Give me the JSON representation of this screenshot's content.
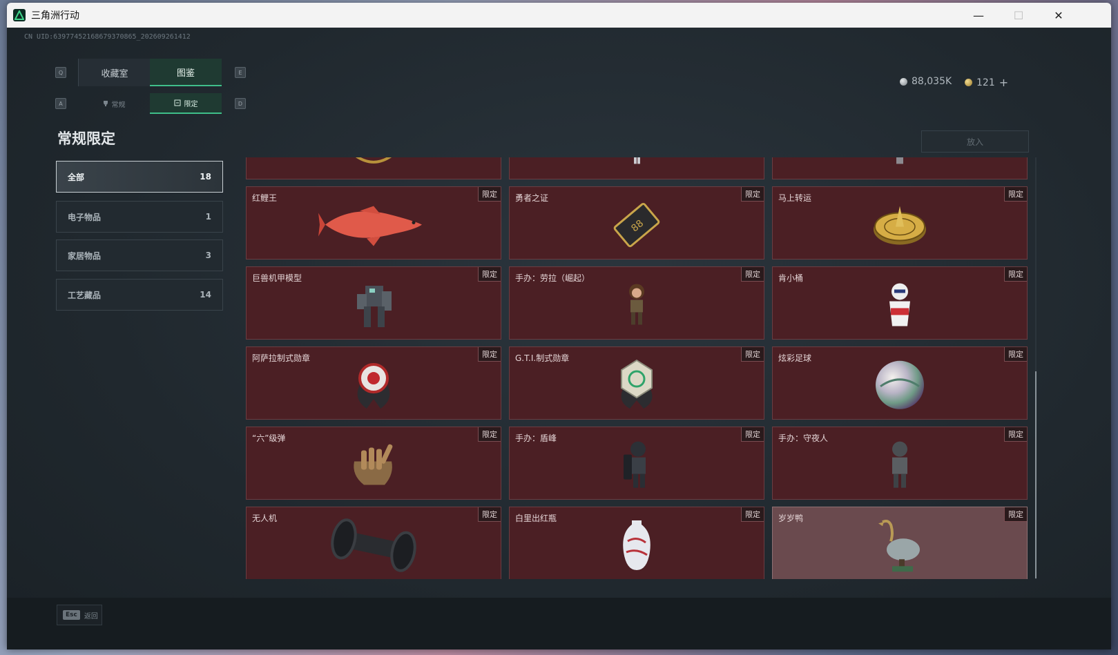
{
  "window": {
    "title": "三角洲行动",
    "controls": [
      "—",
      "☐",
      "✕"
    ]
  },
  "header": {
    "uid": "CN UID:63977452168679370865_202609261412",
    "currency_silver": "88,035K",
    "currency_gold": "121",
    "plus": "+"
  },
  "tabs": {
    "key_left": "Q",
    "key_right": "E",
    "items": [
      {
        "label": "收藏室"
      },
      {
        "label": "图鉴"
      }
    ]
  },
  "subtabs": {
    "key_left": "A",
    "key_right": "D",
    "items": [
      {
        "label": "常规"
      },
      {
        "label": "限定"
      }
    ]
  },
  "section_title": "常规限定",
  "place_button": "放入",
  "categories": [
    {
      "label": "全部",
      "count": "18"
    },
    {
      "label": "电子物品",
      "count": "1"
    },
    {
      "label": "家居物品",
      "count": "3"
    },
    {
      "label": "工艺藏品",
      "count": "14"
    }
  ],
  "badge_label": "限定",
  "items": [
    {
      "name": "",
      "icon": "gold-ornament-icon",
      "badge": ""
    },
    {
      "name": "",
      "icon": "figurine-icon",
      "badge": ""
    },
    {
      "name": "",
      "icon": "figurine-icon",
      "badge": ""
    },
    {
      "name": "红鲤王",
      "icon": "red-carp-icon",
      "badge": "限定"
    },
    {
      "name": "勇者之证",
      "icon": "gold-card-icon",
      "badge": "限定"
    },
    {
      "name": "马上转运",
      "icon": "gold-wheel-icon",
      "badge": "限定"
    },
    {
      "name": "巨兽机甲模型",
      "icon": "mech-model-icon",
      "badge": "限定"
    },
    {
      "name": "手办：劳拉（崛起）",
      "icon": "figurine-icon",
      "badge": "限定"
    },
    {
      "name": "肯小桶",
      "icon": "bucket-mascot-icon",
      "badge": "限定"
    },
    {
      "name": "阿萨拉制式勋章",
      "icon": "medal-icon",
      "badge": "限定"
    },
    {
      "name": "G.T.I.制式勋章",
      "icon": "medal-icon",
      "badge": "限定"
    },
    {
      "name": "炫彩足球",
      "icon": "iridescent-ball-icon",
      "badge": "限定"
    },
    {
      "name": "“六”级弹",
      "icon": "bullet-hand-icon",
      "badge": "限定"
    },
    {
      "name": "手办：盾峰",
      "icon": "figurine-icon",
      "badge": "限定"
    },
    {
      "name": "手办：守夜人",
      "icon": "figurine-icon",
      "badge": "限定"
    },
    {
      "name": "无人机",
      "icon": "drone-roller-icon",
      "badge": "限定"
    },
    {
      "name": "白里出红瓶",
      "icon": "porcelain-vase-icon",
      "badge": "限定"
    },
    {
      "name": "岁岁鸭",
      "icon": "duck-statue-icon",
      "badge": "限定"
    }
  ],
  "footer": {
    "key": "Esc",
    "label": "返回"
  },
  "colors": {
    "accent": "#3fbf8a",
    "card_bg": "#4b1f24",
    "card_border": "#6b3d42"
  }
}
